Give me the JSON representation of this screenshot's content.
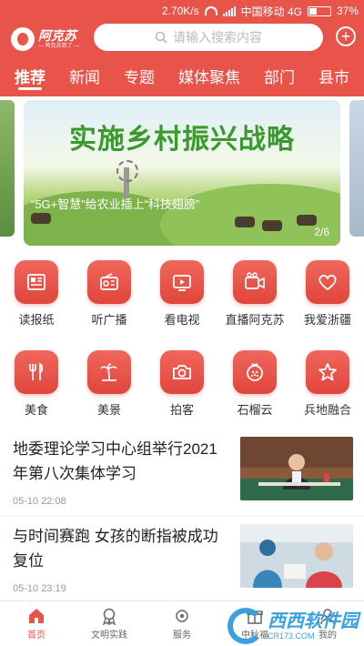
{
  "status_bar": {
    "speed": "2.70K/s",
    "carrier": "中国移动 4G",
    "battery": "37%",
    "battery_level": 0.37
  },
  "header": {
    "logo_name": "阿克苏",
    "logo_slogan": "— 阿克苏到了 —",
    "search_placeholder": "请输入搜索内容",
    "plus_icon": "plus-icon"
  },
  "tabs": [
    {
      "label": "推荐",
      "active": true
    },
    {
      "label": "新闻"
    },
    {
      "label": "专题"
    },
    {
      "label": "媒体聚焦"
    },
    {
      "label": "部门"
    },
    {
      "label": "县市"
    }
  ],
  "banner": {
    "title": "实施乡村振兴战略",
    "caption": "“5G+智慧”给农业插上“科技翅膀”",
    "indicator": "2/6"
  },
  "grid_row1": [
    {
      "label": "读报纸",
      "icon": "newspaper-icon"
    },
    {
      "label": "听广播",
      "icon": "radio-icon"
    },
    {
      "label": "看电视",
      "icon": "tv-icon"
    },
    {
      "label": "直播阿克苏",
      "icon": "video-camera-icon"
    },
    {
      "label": "我爱浙疆",
      "icon": "heart-icon"
    }
  ],
  "grid_row2": [
    {
      "label": "美食",
      "icon": "fork-knife-icon"
    },
    {
      "label": "美景",
      "icon": "palm-tree-icon"
    },
    {
      "label": "拍客",
      "icon": "camera-icon"
    },
    {
      "label": "石榴云",
      "icon": "pomegranate-icon"
    },
    {
      "label": "兵地融合",
      "icon": "star-icon"
    }
  ],
  "news": [
    {
      "title": "地委理论学习中心组举行2021年第八次集体学习",
      "time": "05-10 22:08"
    },
    {
      "title": "与时间赛跑 女孩的断指被成功复位",
      "time": "05-10 23:19"
    }
  ],
  "bottom_nav": [
    {
      "label": "首页",
      "active": true,
      "icon": "home-icon"
    },
    {
      "label": "文明实践",
      "icon": "medal-icon"
    },
    {
      "label": "服务",
      "icon": "service-icon"
    },
    {
      "label": "中秋福",
      "icon": "gift-icon"
    },
    {
      "label": "我的",
      "icon": "user-icon"
    }
  ],
  "watermark": {
    "main": "西西软件园",
    "sub": "CR173.COM"
  },
  "colors": {
    "primary": "#e8534a",
    "text": "#222222",
    "muted": "#999999"
  }
}
